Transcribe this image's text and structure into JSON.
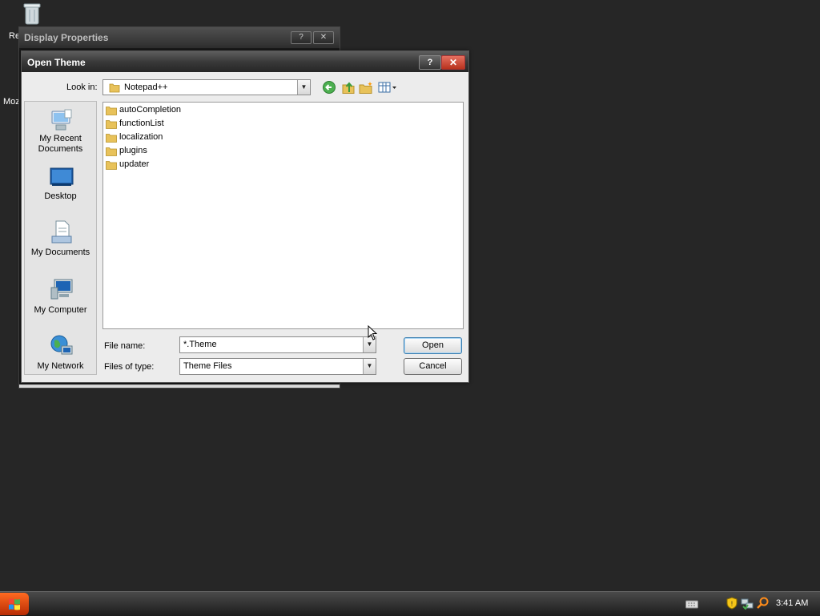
{
  "desktop": {
    "icon_labels": [
      "Re",
      "Moz"
    ]
  },
  "background_window": {
    "title": "Display Properties",
    "help_label": "?",
    "close_label": "✕"
  },
  "dialog": {
    "title": "Open Theme",
    "help_label": "?",
    "close_label": "✕",
    "look_in": {
      "label": "Look in:",
      "value": "Notepad++"
    },
    "places": [
      {
        "label_line1": "My Recent",
        "label_line2": "Documents",
        "icon": "recent-documents-icon"
      },
      {
        "label_line1": "Desktop",
        "label_line2": "",
        "icon": "desktop-icon"
      },
      {
        "label_line1": "My Documents",
        "label_line2": "",
        "icon": "my-documents-icon"
      },
      {
        "label_line1": "My Computer",
        "label_line2": "",
        "icon": "my-computer-icon"
      },
      {
        "label_line1": "My Network",
        "label_line2": "",
        "icon": "my-network-icon"
      }
    ],
    "files": [
      {
        "name": "autoCompletion",
        "type": "folder"
      },
      {
        "name": "functionList",
        "type": "folder"
      },
      {
        "name": "localization",
        "type": "folder"
      },
      {
        "name": "plugins",
        "type": "folder"
      },
      {
        "name": "updater",
        "type": "folder"
      }
    ],
    "file_name": {
      "label": "File name:",
      "value": "*.Theme"
    },
    "files_of_type": {
      "label": "Files of type:",
      "value": "Theme Files"
    },
    "open_label": "Open",
    "cancel_label": "Cancel"
  },
  "taskbar": {
    "clock": "3:41 AM"
  },
  "colors": {
    "desktop": "#262626",
    "dialog_bg": "#ececec",
    "accent_start": "#e8501a",
    "folder": "#e8c25a"
  }
}
